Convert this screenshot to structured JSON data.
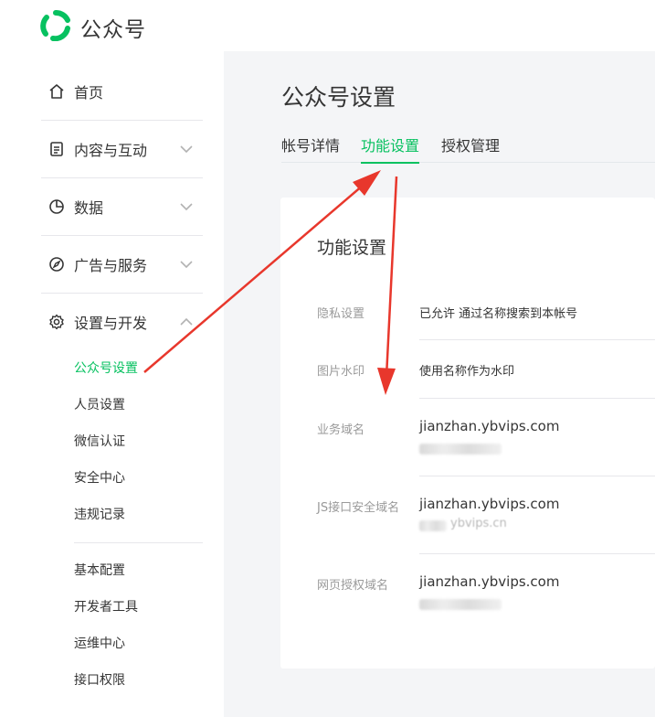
{
  "app": {
    "brand": "公众号"
  },
  "sidebar": {
    "items": [
      {
        "label": "首页",
        "icon": "home-icon"
      },
      {
        "label": "内容与互动",
        "icon": "document-icon"
      },
      {
        "label": "数据",
        "icon": "pie-chart-icon"
      },
      {
        "label": "广告与服务",
        "icon": "compass-icon"
      },
      {
        "label": "设置与开发",
        "icon": "gear-icon"
      }
    ],
    "sub_items": [
      "公众号设置",
      "人员设置",
      "微信认证",
      "安全中心",
      "违规记录"
    ],
    "dev_items": [
      "基本配置",
      "开发者工具",
      "运维中心",
      "接口权限"
    ]
  },
  "main": {
    "title": "公众号设置",
    "tabs": [
      "帐号详情",
      "功能设置",
      "授权管理"
    ],
    "card": {
      "title": "功能设置",
      "privacy": {
        "label": "隐私设置",
        "value": "已允许 通过名称搜索到本帐号"
      },
      "watermark": {
        "label": "图片水印",
        "value": "使用名称作为水印"
      },
      "business_domain": {
        "label": "业务域名",
        "value": "jianzhan.ybvips.com"
      },
      "js_domain": {
        "label": "JS接口安全域名",
        "value": "jianzhan.ybvips.com",
        "partial": "ybvips.cn"
      },
      "auth_domain": {
        "label": "网页授权域名",
        "value": "jianzhan.ybvips.com"
      }
    }
  },
  "colors": {
    "accent": "#07c160",
    "annotation": "#e8372c"
  }
}
